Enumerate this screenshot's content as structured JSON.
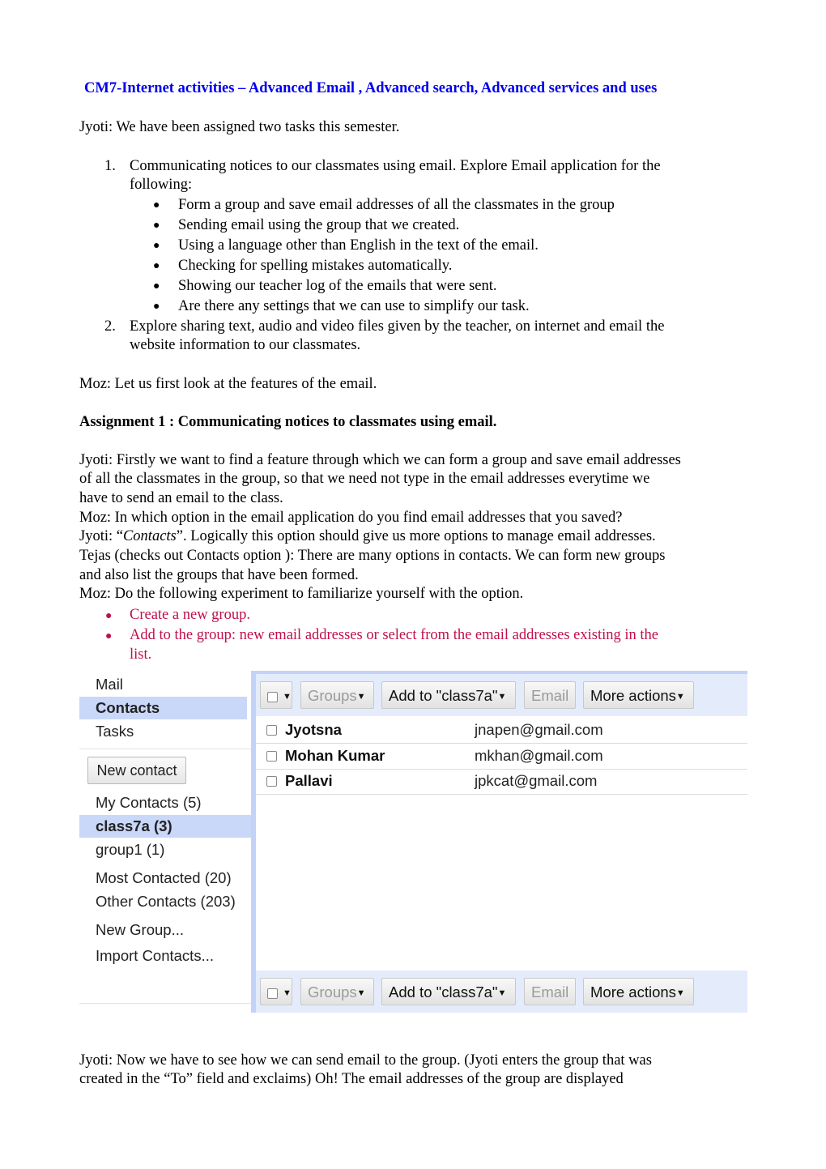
{
  "title": "CM7-Internet activities – Advanced Email , Advanced search, Advanced services and uses",
  "intro": "Jyoti: We have been assigned two tasks this semester.",
  "tasks": [
    {
      "num": "1.",
      "line1": "Communicating  notices to our classmates using email. Explore Email application for the",
      "line2": "following:",
      "bullets": [
        "Form a group and save email addresses of all the classmates in the group",
        "Sending email using the group that we created.",
        "Using a language other than English in the text of the email.",
        "Checking for spelling mistakes automatically.",
        "Showing our teacher log of the emails that were sent.",
        "Are there any settings that we can use to simplify our task."
      ]
    },
    {
      "num": "2.",
      "line1": "Explore sharing text, audio and video files given by the teacher, on internet and email the",
      "line2": "website information to our classmates."
    }
  ],
  "moz_intro": "Moz: Let us first look at the features of the email.",
  "assignment_heading": "Assignment 1 : Communicating  notices to classmates using email.",
  "dialogue": [
    "Jyoti: Firstly we want to find a feature through which we can form a group and save email addresses",
    "of all the classmates in the group, so that we need not type in the email addresses everytime we",
    "have to send an email to the class.",
    "Moz: In which option in the email application  do you find email addresses that you saved?",
    "Tejas (checks out Contacts option ): There are many options in contacts. We can form new groups",
    "and also list the groups that have been formed.",
    "Moz: Do the following experiment to familiarize yourself with the option."
  ],
  "contacts_line": {
    "prefix": "Jyoti: “",
    "italic": "Contacts",
    "suffix": "”. Logically this option should give us more options to manage email addresses."
  },
  "experiment_steps": [
    "Create a new group.",
    "Add to the group: new email addresses  or select from the email addresses existing in the",
    "list."
  ],
  "screenshot": {
    "nav": [
      "Mail",
      "Contacts",
      "Tasks"
    ],
    "new_contact": "New contact",
    "groups": [
      "My Contacts (5)",
      "class7a (3)",
      "group1 (1)"
    ],
    "system_groups": [
      "Most Contacted (20)",
      "Other Contacts (203)"
    ],
    "actions": [
      "New Group...",
      "Import Contacts..."
    ],
    "toolbar": {
      "groups": "Groups",
      "add_to": "Add to \"class7a\"",
      "email": "Email",
      "more_actions": "More actions"
    },
    "contacts": [
      {
        "name": "Jyotsna",
        "email": "jnapen@gmail.com"
      },
      {
        "name": "Mohan Kumar",
        "email": "mkhan@gmail.com"
      },
      {
        "name": "Pallavi",
        "email": "jpkcat@gmail.com"
      }
    ]
  },
  "closing": [
    "Jyoti: Now we have to see how we can send email to the group. (Jyoti enters the group that was",
    "created in the “To” field and exclaims) Oh! The email addresses of the group are displayed"
  ]
}
